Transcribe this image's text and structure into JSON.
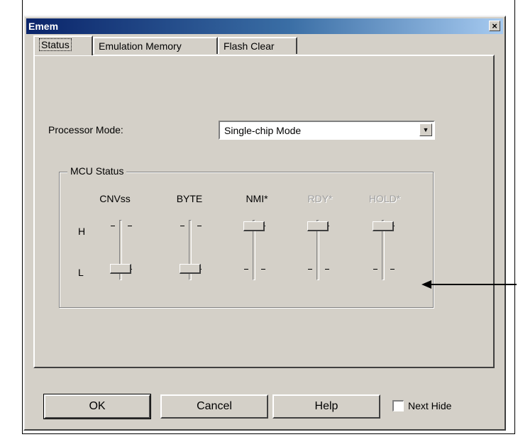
{
  "window": {
    "title": "Emem",
    "close_glyph": "×"
  },
  "tabs": [
    {
      "label": "Status",
      "active": true
    },
    {
      "label": "Emulation Memory",
      "active": false
    },
    {
      "label": "Flash Clear",
      "active": false
    }
  ],
  "processor_mode": {
    "label": "Processor Mode:",
    "value": "Single-chip Mode"
  },
  "mcu_status": {
    "label": "MCU Status",
    "high_label": "H",
    "low_label": "L",
    "sliders": [
      {
        "label": "CNVss",
        "state": "L",
        "enabled": true
      },
      {
        "label": "BYTE",
        "state": "L",
        "enabled": true
      },
      {
        "label": "NMI*",
        "state": "H",
        "enabled": true
      },
      {
        "label": "RDY*",
        "state": "H",
        "enabled": false
      },
      {
        "label": "HOLD*",
        "state": "H",
        "enabled": false
      }
    ]
  },
  "buttons": {
    "ok": "OK",
    "cancel": "Cancel",
    "help": "Help"
  },
  "next_hide": {
    "label": "Next Hide",
    "checked": false
  },
  "colors": {
    "dialog_bg": "#d4d0c8",
    "title_start": "#0a246a",
    "title_end": "#a6caf0"
  }
}
